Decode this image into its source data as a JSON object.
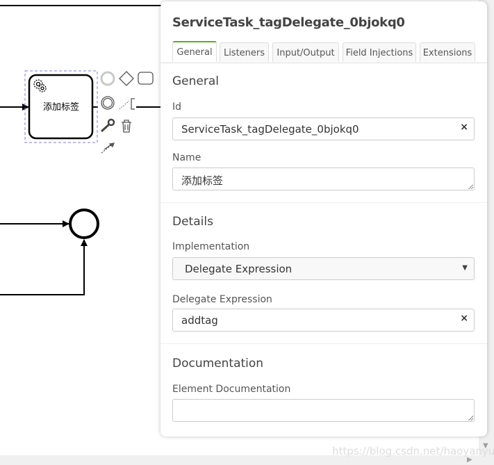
{
  "diagram": {
    "task_label": "添加标签"
  },
  "panel": {
    "title": "ServiceTask_tagDelegate_0bjokq0",
    "tabs": [
      {
        "label": "General",
        "active": true
      },
      {
        "label": "Listeners"
      },
      {
        "label": "Input/Output"
      },
      {
        "label": "Field Injections"
      },
      {
        "label": "Extensions"
      }
    ],
    "general": {
      "heading": "General",
      "id_label": "Id",
      "id_value": "ServiceTask_tagDelegate_0bjokq0",
      "name_label": "Name",
      "name_value": "添加标签"
    },
    "details": {
      "heading": "Details",
      "implementation_label": "Implementation",
      "implementation_value": "Delegate Expression",
      "delegate_label": "Delegate Expression",
      "delegate_value": "addtag"
    },
    "documentation": {
      "heading": "Documentation",
      "element_doc_label": "Element Documentation",
      "element_doc_value": ""
    },
    "clear_symbol": "×",
    "caret_symbol": "▼",
    "accent_color": "#52b415"
  },
  "watermark": "https://blog.csdn.net/haoyanyu"
}
